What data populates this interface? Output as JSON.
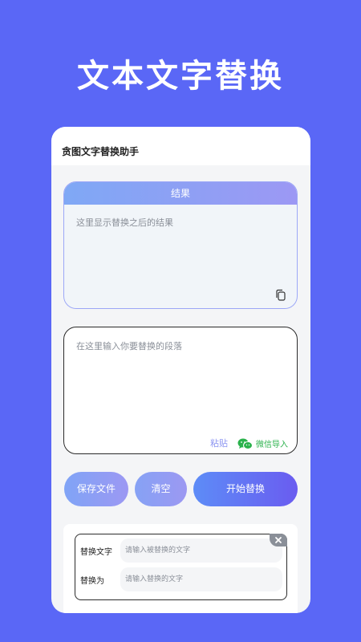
{
  "promo": {
    "title": "文本文字替换"
  },
  "app": {
    "title": "贪图文字替换助手"
  },
  "result": {
    "header": "结果",
    "placeholder": "这里显示替换之后的结果",
    "copy_icon": "copy-icon"
  },
  "input": {
    "placeholder": "在这里输入你要替换的段落",
    "paste_label": "粘贴",
    "wechat_label": "微信导入",
    "wechat_icon": "wechat-icon"
  },
  "actions": {
    "save_label": "保存文件",
    "clear_label": "清空",
    "start_label": "开始替换"
  },
  "rule": {
    "find_label": "替换文字",
    "find_placeholder": "请输入被替换的文字",
    "replace_label": "替换为",
    "replace_placeholder": "请输入替换的文字",
    "close_icon": "close-icon"
  },
  "colors": {
    "background": "#5A67F6",
    "accent_start": "#5D8CF7",
    "accent_end": "#6A5CF0",
    "wechat_green": "#2BB24C"
  }
}
